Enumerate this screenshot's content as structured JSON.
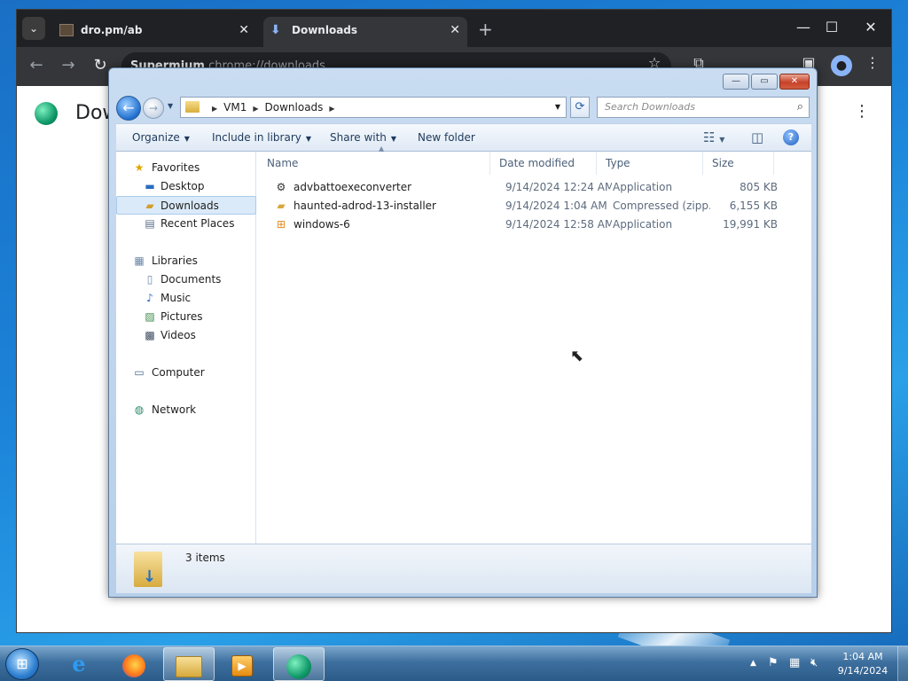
{
  "chrome": {
    "tabs": [
      {
        "title": "dro.pm/ab",
        "close": "✕"
      },
      {
        "title": "Downloads",
        "close": "✕"
      }
    ],
    "new_tab": "+",
    "window_controls": [
      "—",
      "☐",
      "✕"
    ],
    "address": {
      "host": "Supermium",
      "scheme": "chrome://downloads"
    },
    "page_title": "Dow",
    "icons": {
      "back": "back-arrow-icon",
      "forward": "forward-arrow-icon",
      "reload": "reload-icon",
      "star": "star-icon",
      "extensions": "puzzle-icon",
      "profile": "profile-icon"
    }
  },
  "explorer": {
    "caption_buttons": [
      "—",
      "▭",
      "✕"
    ],
    "breadcrumb": [
      "VM1",
      "Downloads"
    ],
    "search_placeholder": "Search Downloads",
    "commands": {
      "organize": "Organize",
      "include_in_library": "Include in library",
      "share_with": "Share with",
      "new_folder": "New folder"
    },
    "nav_pane": {
      "favorites": {
        "label": "Favorites",
        "items": [
          "Desktop",
          "Downloads",
          "Recent Places"
        ]
      },
      "libraries": {
        "label": "Libraries",
        "items": [
          "Documents",
          "Music",
          "Pictures",
          "Videos"
        ]
      },
      "computer": "Computer",
      "network": "Network"
    },
    "columns": [
      "Name",
      "Date modified",
      "Type",
      "Size"
    ],
    "files": [
      {
        "name": "advbattoexeconverter",
        "date": "9/14/2024 12:24 AM",
        "type": "Application",
        "size": "805 KB"
      },
      {
        "name": "haunted-adrod-13-installer",
        "date": "9/14/2024 1:04 AM",
        "type": "Compressed (zipp...",
        "size": "6,155 KB"
      },
      {
        "name": "windows-6",
        "date": "9/14/2024 12:58 AM",
        "type": "Application",
        "size": "19,991 KB"
      }
    ],
    "status": "3 items"
  },
  "taskbar": {
    "time": "1:04 AM",
    "date": "9/14/2024"
  },
  "colors": {
    "accent": "#1f6fd0",
    "chrome_dark": "#202124",
    "selection": "#dbeaf9"
  }
}
